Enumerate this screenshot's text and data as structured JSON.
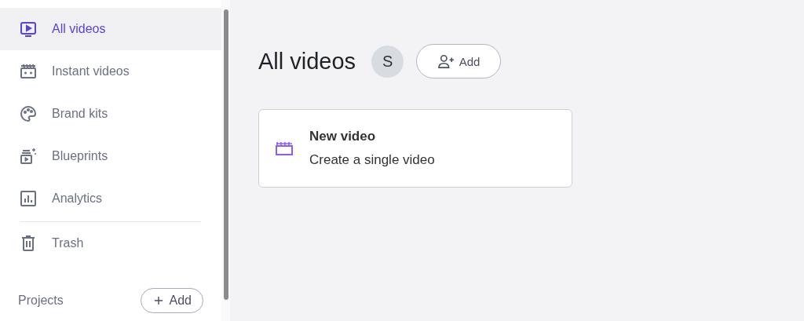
{
  "sidebar": {
    "items": [
      {
        "label": "All videos",
        "kind": "video",
        "selected": true,
        "divider_before": false
      },
      {
        "label": "Instant videos",
        "kind": "clapper",
        "selected": false,
        "divider_before": false
      },
      {
        "label": "Brand kits",
        "kind": "palette",
        "selected": false,
        "divider_before": false
      },
      {
        "label": "Blueprints",
        "kind": "blueprint",
        "selected": false,
        "divider_before": false
      },
      {
        "label": "Analytics",
        "kind": "chart",
        "selected": false,
        "divider_before": false
      },
      {
        "label": "Trash",
        "kind": "trash",
        "selected": false,
        "divider_before": true
      }
    ],
    "projects": {
      "label": "Projects",
      "button": "Add"
    }
  },
  "header": {
    "title": "All videos",
    "avatar": "S",
    "button": "Add"
  },
  "cards": [
    {
      "title": "New video",
      "subtitle": "Create a single video"
    }
  ]
}
